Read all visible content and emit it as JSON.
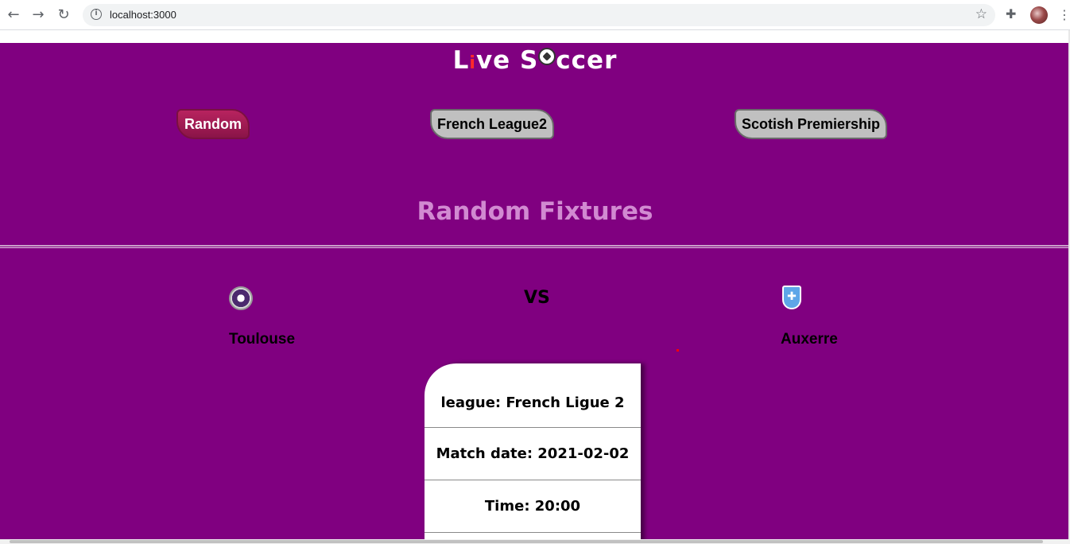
{
  "browser": {
    "url": "localhost:3000"
  },
  "site": {
    "title_part1": "L",
    "title_i": "i",
    "title_part2": "ve S",
    "title_part3": "ccer"
  },
  "tabs": [
    {
      "label": "Random",
      "active": true
    },
    {
      "label": "French League2",
      "active": false
    },
    {
      "label": "Scotish Premiership",
      "active": false
    }
  ],
  "section": {
    "title": "Random Fixtures"
  },
  "fixture": {
    "home_team": "Toulouse",
    "away_team": "Auxerre",
    "vs_label": "VS",
    "league": "league: French Ligue 2",
    "match_date": "Match date: 2021-02-02",
    "time": "Time: 20:00"
  },
  "colors": {
    "page_bg": "#800080",
    "active_tab": "#b8235f",
    "section_title": "#d18ad1"
  }
}
